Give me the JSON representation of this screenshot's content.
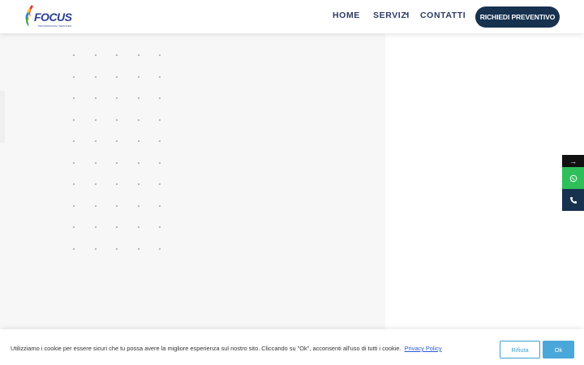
{
  "brand": {
    "name": "FOCUS",
    "tagline": "PROFESSIONAL SERVICES",
    "primary_color": "#17324f",
    "accent_color": "#2a3f8f"
  },
  "nav": {
    "items": [
      {
        "label": "HOME"
      },
      {
        "label": "SERVIZI",
        "icon": "chevron-down-icon"
      },
      {
        "label": "CONTATTI"
      }
    ],
    "cta_label": "RICHIEDI PREVENTIVO"
  },
  "side_buttons": [
    {
      "label": "→",
      "icon": "arrow-right-icon"
    },
    {
      "icon": "whatsapp-icon",
      "color": "#2fbf5a"
    },
    {
      "icon": "phone-icon",
      "color": "#17324f"
    }
  ],
  "cookie": {
    "text": "Utilizziamo i cookie per essere sicuri che tu possa avere la migliore esperienza sul nostro sito. Cliccando su \"Ok\", acconsenti all'uso di tutti i cookie.",
    "link_label": "Privacy Policy",
    "reject_label": "Rifiuta",
    "accept_label": "Ok"
  }
}
